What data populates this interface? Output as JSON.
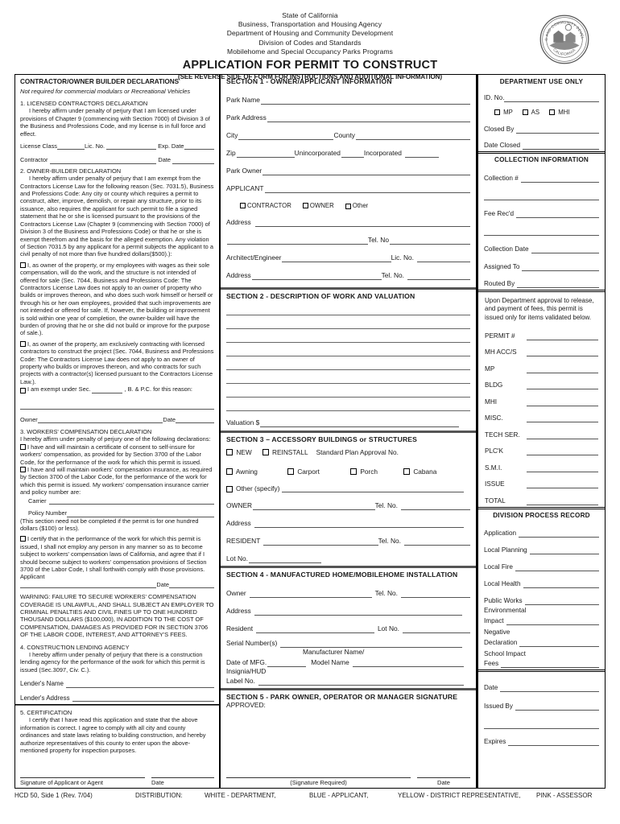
{
  "header": {
    "agency_lines": [
      "State of California",
      "Business, Transportation and Housing Agency",
      "Department of Housing and Community Development",
      "Division of Codes and Standards",
      "Mobilehome and Special Occupancy Parks Programs"
    ],
    "title": "APPLICATION FOR PERMIT TO CONSTRUCT",
    "subnote": "(SEE REVERSE SIDE OF FORM FOR INSTRUCTIONS AND ADDITIONAL INFORMATION)",
    "seal_top_text": "HOUSING AND COMMUNITY DEVELOPMENT",
    "seal_bottom_text": "CALIFORNIA"
  },
  "left": {
    "title": "CONTRACTOR/OWNER BUILDER DECLARATIONS",
    "subtitle": "Not required for commercial modulars or Recreational Vehicles",
    "d1_heading": "1. LICENSED CONTRACTORS DECLARATION",
    "d1_body": "I hereby affirm under penalty of perjury that I am licensed under provisions of Chapter 9 (commencing with Section 7000) of Division 3 of the Business and Professions Code, and my license is in full force and effect.",
    "license_class_label": "License Class",
    "lic_no_label": "Lic. No.",
    "exp_date_label": "Exp. Date",
    "contractor_label": "Contractor",
    "contractor_date_label": "Date",
    "d2_heading": "2. OWNER-BUILDER DECLARATION",
    "d2_body": "I hereby affirm under penalty of perjury that I am exempt from the Contractors License Law for the following reason (Sec. 7031.5), Business and Professions Code:  Any city or county which requires a permit to construct, alter, improve, demolish, or repair any structure, prior to its issuance, also requires the applicant for such permit to file a signed statement that he or she is licensed pursuant to the provisions of the Contractors License Law (Chapter 9 (commencing with Section 7000) of Division 3 of the Business and Professions Code) or that he or she is exempt therefrom and the basis for the alleged exemption.  Any violation of Section 7031.5 by any applicant for a permit subjects the applicant to a civil penalty of not more than five hundred dollars($500).):",
    "d2_cb1": "I, as owner of the property, or my employees with wages as their sole compensation, will do the work, and the structure is not intended of offered for sale (Sec. 7044, Business and Professions Code:  The Contractors License Law does not apply to an owner of property who builds or improves thereon, and who does such work himself or herself or through his or her own employees, provided that such improvements are not intended or offered for sale.  If, however, the building or improvement is sold within one year of completion, the owner-builder will have the burden of proving that he or she did not build or improve for the purpose of sale.).",
    "d2_cb2": "I, as owner of the property, am exclusively contracting with licensed contractors to construct the project (Sec. 7044, Business and Professions Code:  The Contractors License Law does not apply to an owner of property who builds or improves thereon, and who contracts for such projects with a contractor(s) licensed pursuant to the Contractors License Law.).",
    "d2_cb3_pre": "I am exempt under Sec.",
    "d2_cb3_post": ", B. & P.C. for this reason:",
    "owner_label": "Owner",
    "owner_date_label": "Date",
    "d3_heading": "3. WORKERS' COMPENSATION DECLARATION",
    "d3_body": "I hereby affirm under penalty of perjury one of the following declarations:",
    "d3_cb1": "I have and will maintain a certificate of consent to self-insure for workers' compensation, as provided for by Section 3700 of the Labor Code, for the performance of the work for which this permit is issued.",
    "d3_cb2": "I have and will maintain workers' compensation insurance, as required by Section 3700 of the Labor Code, for the performance of the work for which this permit is issued.  My workers' compensation insurance carrier and policy number are:",
    "carrier_label": "Carrier",
    "policy_number_label": "Policy Number",
    "policy_note": "(This section need not be completed if the permit is for one hundred dollars ($100) or less).",
    "d3_cb3": "I certify that in the performance of the work for which this permit is issued, I shall not employ any person in any manner so as to become subject to workers' compensation laws of California, and agree that if I should become subject to workers' compensation provisions of Section 3700 of the Labor Code, I shall forthwith comply with those provisions.",
    "applicant_label": "Applicant",
    "applicant_date_label": "Date",
    "warning": "WARNING: FAILURE TO SECURE WORKERS' COMPENSATION COVERAGE IS UNLAWFUL, AND SHALL SUBJECT AN EMPLOYER TO CRIMINAL PENALTIES AND CIVIL FINES UP TO ONE HUNDRED THOUSAND DOLLARS ($100,000), IN ADDITION TO THE COST OF COMPENSATION, DAMAGES AS PROVIDED FOR IN SECTION 3706 OF THE LABOR CODE, INTEREST, AND ATTORNEY'S FEES.",
    "d4_heading": "4. CONSTRUCTION LENDING AGENCY",
    "d4_body": "I hereby affirm under penalty of perjury that there is a construction lending agency for the performance of the work for which this permit is issued (Sec.3097, Civ. C.).",
    "lenders_name_label": "Lender's Name",
    "lenders_address_label": "Lender's Address",
    "d5_heading": "5. CERTIFICATION",
    "d5_body": "I certify that I have read this application and state that the above information is correct.  I agree to comply with all city and county ordinances and state laws relating to building construction, and hereby authorize representatives of this county to enter upon the above-mentioned property for inspection purposes.",
    "sig_caption": "Signature of Applicant or Agent",
    "sig_date_caption": "Date"
  },
  "section1": {
    "title": "SECTION 1 - OWNER/APPLICANT INFORMATION",
    "park_name": "Park Name",
    "park_address": "Park Address",
    "city": "City",
    "county": "County",
    "zip": "Zip",
    "unincorporated": "Unincorporated",
    "incorporated": "Incorporated",
    "park_owner": "Park Owner",
    "applicant": "APPLICANT",
    "cb_contractor": "CONTRACTOR",
    "cb_owner": "OWNER",
    "cb_other": "Other",
    "address": "Address",
    "tel_no": "Tel. No",
    "architect_engineer": "Architect/Engineer",
    "lic_no": "Lic. No.",
    "address2": "Address",
    "tel_no2": "Tel. No."
  },
  "section2": {
    "title": "SECTION 2 - DESCRIPTION OF WORK AND VALUATION",
    "blank_line_count": 8,
    "valuation": "Valuation  $"
  },
  "section3": {
    "title": "SECTION 3 – ACCESSORY  BUILDINGS or STRUCTURES",
    "cb_new": "NEW",
    "cb_reinstall": "REINSTALL",
    "std_plan": "Standard Plan Approval No.",
    "cb_awning": "Awning",
    "cb_carport": "Carport",
    "cb_porch": "Porch",
    "cb_cabana": "Cabana",
    "cb_other": "Other (specify)",
    "owner": "OWNER",
    "tel_no": "Tel. No.",
    "address": "Address",
    "resident": "RESIDENT",
    "tel_no2": "Tel. No.",
    "lot_no": "Lot No."
  },
  "section4": {
    "title": "SECTION 4 - MANUFACTURED HOME/MOBILEHOME INSTALLATION",
    "owner": "Owner",
    "tel_no": "Tel. No.",
    "address": "Address",
    "resident": "Resident",
    "lot_no": "Lot No.",
    "serial_numbers": "Serial Number(s)",
    "date_of_mfg": "Date of MFG.",
    "manufacturer_name": "Manufacturer Name/",
    "model_name": "Model Name",
    "insignia_hud": "Insignia/HUD",
    "label_no": "Label No."
  },
  "section5": {
    "title": "SECTION 5 - PARK OWNER, OPERATOR OR MANAGER SIGNATURE",
    "approved": "APPROVED:",
    "sig_caption": "(Signature Required)",
    "date_caption": "Date"
  },
  "dept": {
    "title": "DEPARTMENT USE ONLY",
    "id_no": "ID. No.",
    "cb_mp": "MP",
    "cb_as": "AS",
    "cb_mhi": "MHI",
    "closed_by": "Closed By",
    "date_closed": "Date Closed",
    "collection_title": "COLLECTION INFORMATION",
    "collection_number": "Collection #",
    "fee_recd": "Fee Rec'd",
    "collection_date": "Collection Date",
    "assigned_to": "Assigned To",
    "routed_by": "Routed By",
    "approval_note": "Upon Department approval to release, and payment of fees, this permit is issued only for items validated below.",
    "fees": [
      "PERMIT #",
      "MH ACC/S",
      "MP",
      "BLDG",
      "MHI",
      "MISC.",
      "TECH SER.",
      "PLC'K",
      "S.M.I.",
      "ISSUE",
      "TOTAL"
    ],
    "process_title": "DIVISION PROCESS RECORD",
    "process_items": [
      "Application",
      "Local Planning",
      "Local Fire",
      "Local Health",
      "Public Works"
    ],
    "process_multi": [
      {
        "l1": "Environmental",
        "l2": "Impact"
      },
      {
        "l1": "Negative",
        "l2": "Declaration"
      },
      {
        "l1": "School Impact",
        "l2": "Fees"
      }
    ],
    "date": "Date",
    "issued_by": "Issued By",
    "expires": "Expires"
  },
  "footer": {
    "form_id": "HCD 50, Side 1 (Rev. 7/04)",
    "distribution_label": "DISTRIBUTION:",
    "copies": [
      "WHITE - DEPARTMENT,",
      "BLUE  - APPLICANT,",
      "YELLOW - DISTRICT REPRESENTATIVE,",
      "PINK - ASSESSOR"
    ]
  }
}
